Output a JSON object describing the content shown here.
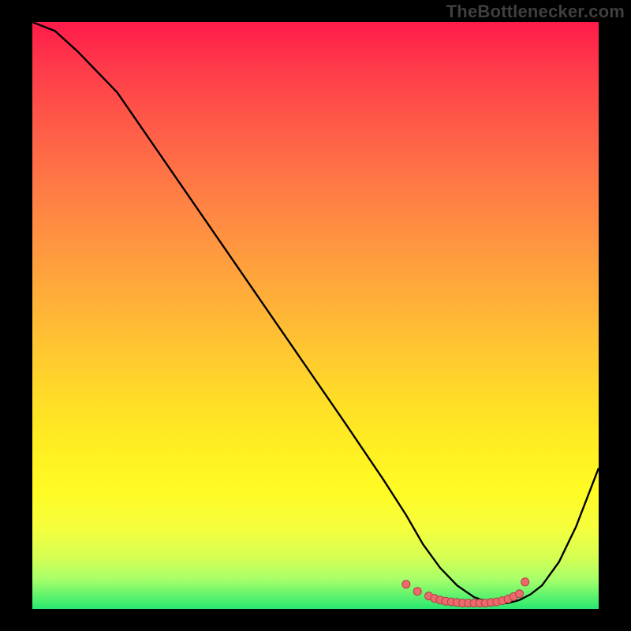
{
  "watermark": "TheBottlenecker.com",
  "colors": {
    "background": "#000000",
    "curve": "#000000",
    "markers_fill": "#ed6a6c",
    "markers_stroke": "#b24048"
  },
  "chart_data": {
    "type": "line",
    "title": "",
    "xlabel": "",
    "ylabel": "",
    "xlim": [
      0,
      100
    ],
    "ylim": [
      0,
      100
    ],
    "series": [
      {
        "name": "curve",
        "x": [
          0,
          4,
          8,
          15,
          25,
          35,
          45,
          55,
          62,
          66,
          69,
          72,
          75,
          78,
          81,
          84,
          86,
          88,
          90,
          93,
          96,
          100
        ],
        "y": [
          100,
          98.5,
          95,
          88,
          74,
          60,
          46,
          32,
          22,
          16,
          11,
          7,
          4,
          2,
          1,
          1,
          1.5,
          2.5,
          4,
          8,
          14,
          24
        ]
      }
    ],
    "markers": {
      "name": "highlight-dots",
      "x": [
        66,
        68,
        70,
        71,
        72,
        73,
        74,
        75,
        76,
        77,
        78,
        79,
        80,
        81,
        82,
        83,
        84,
        85,
        86,
        87
      ],
      "y": [
        4.2,
        3.0,
        2.2,
        1.8,
        1.5,
        1.3,
        1.2,
        1.1,
        1.0,
        1.0,
        1.0,
        1.0,
        1.0,
        1.1,
        1.2,
        1.4,
        1.7,
        2.1,
        2.6,
        4.6
      ]
    }
  }
}
